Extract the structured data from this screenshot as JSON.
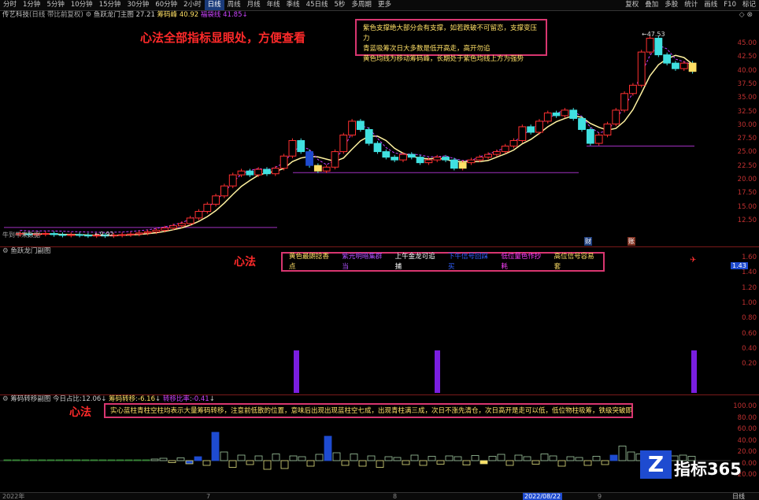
{
  "toolbar": {
    "periods": [
      "分时",
      "1分钟",
      "5分钟",
      "10分钟",
      "15分钟",
      "30分钟",
      "60分钟",
      "2小时",
      "日线",
      "周线",
      "月线",
      "年线",
      "季线",
      "45日线",
      "5秒",
      "多周期",
      "更多"
    ],
    "active_period": "日线",
    "right_buttons": [
      "复权",
      "叠加",
      "多股",
      "统计",
      "画线",
      "F10",
      "标记"
    ]
  },
  "main_panel": {
    "stock_name": "传艺科技",
    "title_suffix": "(日线 带比前复权)",
    "indicator_name": "鱼跃龙门主图",
    "val1": "27.21",
    "label2": "筹码峰",
    "val2": "40.92",
    "label3": "福袋线",
    "val3": "41.85",
    "left_note": "牛到牛来数据",
    "low_label": "9.92",
    "high_label": "47.53",
    "axis_labels": [
      "45.00",
      "42.50",
      "40.00",
      "37.50",
      "35.00",
      "32.50",
      "30.00",
      "27.50",
      "25.00",
      "22.50",
      "20.00",
      "17.50",
      "15.00",
      "12.50"
    ],
    "callout_lines": [
      "紫色支撑绝大部分会有支撑，如若跌破不可留恋，支撑变压力",
      "青蓝吸筹次日大多数是低开高走，高开勿追",
      "黄色均线为移动筹码峰，长期处于紫色均线上方为强势"
    ],
    "big_note": "心法全部指标显眼处，方便查看",
    "markers": [
      "财",
      "账"
    ]
  },
  "sub_panel1": {
    "title": "鱼跃龙门副图",
    "legend": [
      "黄色最朗捻香点",
      "紫光明暗集群当",
      "上午金龙可追捕",
      "下午信号回踩买",
      "低位量色作抄耗",
      "高位信号容易套"
    ],
    "note": "心法",
    "axis_labels": [
      "1.60",
      "1.40",
      "1.20",
      "1.00",
      "0.80",
      "0.60",
      "0.40",
      "0.20"
    ],
    "current_tag": "1.43"
  },
  "sub_panel2": {
    "title": "筹码转移副图",
    "today_label": "今日占比",
    "today_val": "12.06",
    "t2_label": "筹码转移",
    "t2_val": "-6.16",
    "t3_label": "转移比率",
    "t3_val": "-0.41",
    "note": "心法",
    "callout": "实心蓝柱青柱空柱均表示大量筹码转移，注意前低散的位置，意味后出现出现蓝柱空七成，出现青柱满三成，次日不涨先清仓，次日高开是走可以低，低位物柱吸筹，铁级突破即横牛",
    "axis_labels": [
      "100.00",
      "80.00",
      "60.00",
      "40.00",
      "20.00",
      "0.00",
      "-20.00"
    ]
  },
  "bottom": {
    "year": "2022年",
    "m1": "7",
    "m2": "8",
    "date": "2022/08/22",
    "m3": "9",
    "tab": "日线"
  },
  "watermark": {
    "a": "Z",
    "b": "指标365"
  },
  "chart_data": {
    "type": "candlestick",
    "ylim": [
      10,
      48
    ],
    "candles": [
      [
        11.0,
        11.2
      ],
      [
        11.1,
        11.0
      ],
      [
        11.0,
        11.1
      ],
      [
        11.1,
        11.2
      ],
      [
        11.2,
        11.0
      ],
      [
        11.0,
        10.9
      ],
      [
        10.9,
        11.0
      ],
      [
        11.0,
        10.9
      ],
      [
        10.9,
        10.8
      ],
      [
        10.8,
        10.9
      ],
      [
        10.9,
        10.8
      ],
      [
        10.8,
        10.9
      ],
      [
        10.9,
        11.0
      ],
      [
        11.0,
        11.1
      ],
      [
        11.1,
        11.3
      ],
      [
        11.3,
        11.5
      ],
      [
        11.5,
        11.8
      ],
      [
        11.8,
        12.2
      ],
      [
        12.2,
        12.6
      ],
      [
        12.6,
        13.0
      ],
      [
        13.0,
        14.0
      ],
      [
        14.0,
        15.2
      ],
      [
        15.2,
        16.5
      ],
      [
        16.5,
        18.0
      ],
      [
        18.0,
        19.8
      ],
      [
        19.8,
        21.8
      ],
      [
        21.8,
        22.5
      ],
      [
        22.5,
        21.8
      ],
      [
        21.8,
        22.8
      ],
      [
        22.8,
        22.0
      ],
      [
        22.0,
        23.0
      ],
      [
        23.0,
        25.2
      ],
      [
        25.2,
        28.0
      ],
      [
        28.0,
        26.0
      ],
      [
        26.0,
        23.5
      ],
      [
        23.5,
        22.5
      ],
      [
        22.5,
        23.2
      ],
      [
        23.2,
        26.0
      ],
      [
        26.0,
        29.0
      ],
      [
        29.0,
        31.5
      ],
      [
        31.5,
        30.0
      ],
      [
        30.0,
        27.5
      ],
      [
        27.5,
        26.0
      ],
      [
        26.0,
        25.0
      ],
      [
        25.0,
        24.5
      ],
      [
        24.5,
        25.5
      ],
      [
        25.5,
        25.0
      ],
      [
        25.0,
        24.0
      ],
      [
        24.0,
        24.5
      ],
      [
        24.5,
        25.0
      ],
      [
        25.0,
        24.5
      ],
      [
        24.5,
        23.0
      ],
      [
        23.0,
        24.0
      ],
      [
        24.0,
        24.5
      ],
      [
        24.5,
        25.0
      ],
      [
        25.0,
        25.5
      ],
      [
        25.5,
        26.0
      ],
      [
        26.0,
        27.0
      ],
      [
        27.0,
        28.0
      ],
      [
        28.0,
        30.5
      ],
      [
        30.5,
        29.5
      ],
      [
        29.5,
        31.5
      ],
      [
        31.5,
        33.0
      ],
      [
        33.0,
        32.5
      ],
      [
        32.5,
        33.5
      ],
      [
        33.5,
        32.0
      ],
      [
        32.0,
        30.0
      ],
      [
        30.0,
        27.5
      ],
      [
        27.5,
        29.0
      ],
      [
        29.0,
        31.0
      ],
      [
        31.0,
        33.5
      ],
      [
        33.5,
        36.5
      ],
      [
        36.5,
        38.0
      ],
      [
        38.0,
        44.0
      ],
      [
        44.0,
        46.5
      ],
      [
        46.5,
        43.5
      ],
      [
        43.5,
        42.0
      ],
      [
        42.0,
        41.0
      ],
      [
        41.0,
        42.0
      ],
      [
        42.0,
        40.5
      ]
    ]
  }
}
